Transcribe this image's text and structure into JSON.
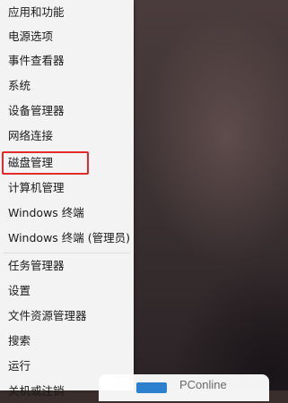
{
  "menu": {
    "items": [
      {
        "label": "应用和功能"
      },
      {
        "label": "电源选项"
      },
      {
        "label": "事件查看器"
      },
      {
        "label": "系统"
      },
      {
        "label": "设备管理器"
      },
      {
        "label": "网络连接"
      },
      {
        "label": "磁盘管理",
        "highlighted": true
      },
      {
        "label": "计算机管理"
      },
      {
        "label": "Windows 终端"
      },
      {
        "label": "Windows 终端 (管理员)"
      },
      {
        "label": "任务管理器"
      },
      {
        "label": "设置"
      },
      {
        "label": "文件资源管理器"
      },
      {
        "label": "搜索"
      },
      {
        "label": "运行"
      },
      {
        "label": "关机或注销"
      }
    ]
  },
  "watermark": {
    "text": "PConline"
  },
  "colors": {
    "menu_background": "#f3f3f3",
    "highlight_border": "#e12a2a",
    "watermark_logo": "#2e86d6"
  }
}
